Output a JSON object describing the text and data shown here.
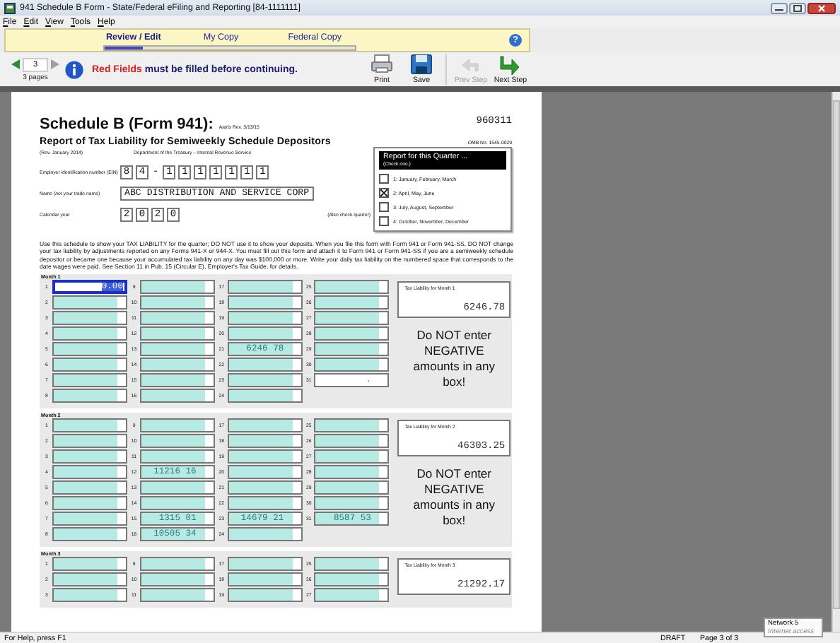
{
  "window": {
    "title": "941 Schedule B Form - State/Federal eFiling and Reporting [84-1111111]"
  },
  "menu": [
    "File",
    "Edit",
    "View",
    "Tools",
    "Help"
  ],
  "tabs": [
    {
      "label": "Review / Edit",
      "selected": true
    },
    {
      "label": "My Copy",
      "selected": false
    },
    {
      "label": "Federal Copy",
      "selected": false
    }
  ],
  "progress": {
    "level": 0.15
  },
  "help": "?",
  "toolbar": {
    "page": "3",
    "pages": "3 pages",
    "message": {
      "highlight": "Red Fields",
      "rest": "must be filled before continuing."
    },
    "buttons": [
      {
        "label": "Print",
        "kind": "print",
        "disabled": false
      },
      {
        "label": "Save",
        "kind": "save",
        "disabled": false
      },
      {
        "label": "Prev Step",
        "kind": "prev",
        "disabled": true
      },
      {
        "label": "Next Step",
        "kind": "next",
        "disabled": false
      }
    ]
  },
  "form": {
    "title": "Schedule B (Form 941):",
    "revision_note": "Aatrix Rev. 3/13/15",
    "code": "960311",
    "subtitle": "Report of Tax Liability for Semiweekly Schedule Depositors",
    "rev": "(Rev. January 2014)",
    "department": "Department of the Treasury – Internal Revenue Service",
    "omb": "OMB No. 1545-0029",
    "ein": {
      "label": "Employer identification number (EIN)",
      "prefix": [
        "8",
        "4"
      ],
      "separator": "-",
      "suffix": [
        "1",
        "1",
        "1",
        "1",
        "1",
        "1",
        "1"
      ]
    },
    "name": {
      "label": "Name (*not* your trade name)",
      "value": "ABC DISTRIBUTION AND SERVICE CORP"
    },
    "year": {
      "label": "Calendar year",
      "digits": [
        "2",
        "0",
        "2",
        "0"
      ],
      "note": "(Also check quarter)"
    },
    "quarter": {
      "title": "Report for this Quarter ...",
      "hint": "(Check one.)",
      "options": [
        {
          "label": "1: January, February, March",
          "checked": false
        },
        {
          "label": "2: April, May, June",
          "checked": true
        },
        {
          "label": "3: July, August, September",
          "checked": false
        },
        {
          "label": "4: October, November, December",
          "checked": false
        }
      ]
    },
    "instructions": "Use this schedule to show your TAX LIABILITY for the quarter; DO NOT use it to show your deposits. When you file this form with Form 941 or Form 941-SS, DO NOT change your tax liability by adjustments reported on any Forms 941-X or 944-X. You must fill out this form and attach it to Form 941 or Form 941-SS if you are a semiweekly schedule depositor or became one because your accumulated tax liability on any day was $100,000 or more. Write your daily tax liability on the numbered space that corresponds to the date wages were paid. See Section 11 in Pub. 15 (Circular E), Employer's Tax Guide, for details.",
    "months": [
      {
        "label": "Month 1",
        "total_label": "Tax Liability for Month 1",
        "total": "6246.78",
        "warning": "Do NOT enter NEGATIVE amounts in any box!",
        "columns": [
          [
            {
              "day": "1",
              "value": "0.00",
              "shaded": false,
              "focused": true
            },
            {
              "day": "2",
              "shaded": true,
              "focused": false
            },
            {
              "day": "3",
              "shaded": true,
              "focused": false
            },
            {
              "day": "4",
              "shaded": true,
              "focused": false
            },
            {
              "day": "5",
              "shaded": true,
              "focused": false
            },
            {
              "day": "6",
              "shaded": true,
              "focused": false
            },
            {
              "day": "7",
              "shaded": true,
              "focused": false
            },
            {
              "day": "8",
              "shaded": true,
              "focused": false
            }
          ],
          [
            {
              "day": "9",
              "shaded": true,
              "focused": false
            },
            {
              "day": "10",
              "shaded": true,
              "focused": false
            },
            {
              "day": "11",
              "shaded": true,
              "focused": false
            },
            {
              "day": "12",
              "shaded": true,
              "focused": false
            },
            {
              "day": "13",
              "shaded": true,
              "focused": false
            },
            {
              "day": "14",
              "shaded": true,
              "focused": false
            },
            {
              "day": "15",
              "shaded": true,
              "focused": false
            },
            {
              "day": "16",
              "shaded": true,
              "focused": false
            }
          ],
          [
            {
              "day": "17",
              "shaded": true,
              "focused": false
            },
            {
              "day": "18",
              "shaded": true,
              "focused": false
            },
            {
              "day": "19",
              "shaded": true,
              "focused": false
            },
            {
              "day": "20",
              "shaded": true,
              "focused": false
            },
            {
              "day": "21",
              "value": "6246 78",
              "shaded": true,
              "focused": false
            },
            {
              "day": "22",
              "shaded": true,
              "focused": false
            },
            {
              "day": "23",
              "shaded": true,
              "focused": false
            },
            {
              "day": "24",
              "shaded": true,
              "focused": false
            }
          ],
          [
            {
              "day": "25",
              "shaded": true,
              "focused": false
            },
            {
              "day": "26",
              "shaded": true,
              "focused": false
            },
            {
              "day": "27",
              "shaded": true,
              "focused": false
            },
            {
              "day": "28",
              "shaded": true,
              "focused": false
            },
            {
              "day": "29",
              "shaded": true,
              "focused": false
            },
            {
              "day": "30",
              "shaded": true,
              "focused": false
            },
            {
              "day": "31",
              "value": ".",
              "shaded": false,
              "focused": false
            }
          ]
        ]
      },
      {
        "label": "Month 2",
        "total_label": "Tax Liability for Month 2",
        "total": "46303.25",
        "warning": "Do NOT enter NEGATIVE amounts in any box!",
        "columns": [
          [
            {
              "day": "1",
              "shaded": true,
              "focused": false
            },
            {
              "day": "2",
              "shaded": true,
              "focused": false
            },
            {
              "day": "3",
              "shaded": true,
              "focused": false
            },
            {
              "day": "4",
              "shaded": true,
              "focused": false
            },
            {
              "day": "5",
              "shaded": true,
              "focused": false
            },
            {
              "day": "6",
              "shaded": true,
              "focused": false
            },
            {
              "day": "7",
              "shaded": true,
              "focused": false
            },
            {
              "day": "8",
              "shaded": true,
              "focused": false
            }
          ],
          [
            {
              "day": "9",
              "shaded": true,
              "focused": false
            },
            {
              "day": "10",
              "shaded": true,
              "focused": false
            },
            {
              "day": "11",
              "shaded": true,
              "focused": false
            },
            {
              "day": "12",
              "value": "11216 16",
              "shaded": true,
              "focused": false
            },
            {
              "day": "13",
              "shaded": true,
              "focused": false
            },
            {
              "day": "14",
              "shaded": true,
              "focused": false
            },
            {
              "day": "15",
              "value": "1315 01",
              "shaded": true,
              "focused": false
            },
            {
              "day": "16",
              "value": "10505 34",
              "shaded": true,
              "focused": false
            }
          ],
          [
            {
              "day": "17",
              "shaded": true,
              "focused": false
            },
            {
              "day": "18",
              "shaded": true,
              "focused": false
            },
            {
              "day": "19",
              "shaded": true,
              "focused": false
            },
            {
              "day": "20",
              "shaded": true,
              "focused": false
            },
            {
              "day": "21",
              "shaded": true,
              "focused": false
            },
            {
              "day": "22",
              "shaded": true,
              "focused": false
            },
            {
              "day": "23",
              "value": "14679 21",
              "shaded": true,
              "focused": false
            },
            {
              "day": "24",
              "shaded": true,
              "focused": false
            }
          ],
          [
            {
              "day": "25",
              "shaded": true,
              "focused": false
            },
            {
              "day": "26",
              "shaded": true,
              "focused": false
            },
            {
              "day": "27",
              "shaded": true,
              "focused": false
            },
            {
              "day": "28",
              "shaded": true,
              "focused": false
            },
            {
              "day": "29",
              "shaded": true,
              "focused": false
            },
            {
              "day": "30",
              "shaded": true,
              "focused": false
            },
            {
              "day": "31",
              "value": "8587 53",
              "shaded": true,
              "focused": false
            }
          ]
        ]
      },
      {
        "label": "Month 3",
        "total_label": "Tax Liability for Month 3",
        "total": "21292.17",
        "columns": [
          [
            {
              "day": "1",
              "shaded": true,
              "focused": false
            },
            {
              "day": "2",
              "shaded": true,
              "focused": false
            },
            {
              "day": "3",
              "shaded": true,
              "focused": false
            }
          ],
          [
            {
              "day": "9",
              "shaded": true,
              "focused": false
            },
            {
              "day": "10",
              "shaded": true,
              "focused": false
            },
            {
              "day": "11",
              "shaded": true,
              "focused": false
            }
          ],
          [
            {
              "day": "17",
              "shaded": true,
              "focused": false
            },
            {
              "day": "18",
              "shaded": true,
              "focused": false
            },
            {
              "day": "19",
              "shaded": true,
              "focused": false
            }
          ],
          [
            {
              "day": "25",
              "shaded": true,
              "focused": false
            },
            {
              "day": "26",
              "shaded": true,
              "focused": false
            },
            {
              "day": "27",
              "shaded": true,
              "focused": false
            }
          ]
        ]
      }
    ]
  },
  "status_bar": {
    "help": "For Help, press F1",
    "mode": "DRAFT",
    "page": "Page 3 of 3"
  },
  "tooltip": {
    "title": "Network 5",
    "subtitle": "Internet access"
  }
}
